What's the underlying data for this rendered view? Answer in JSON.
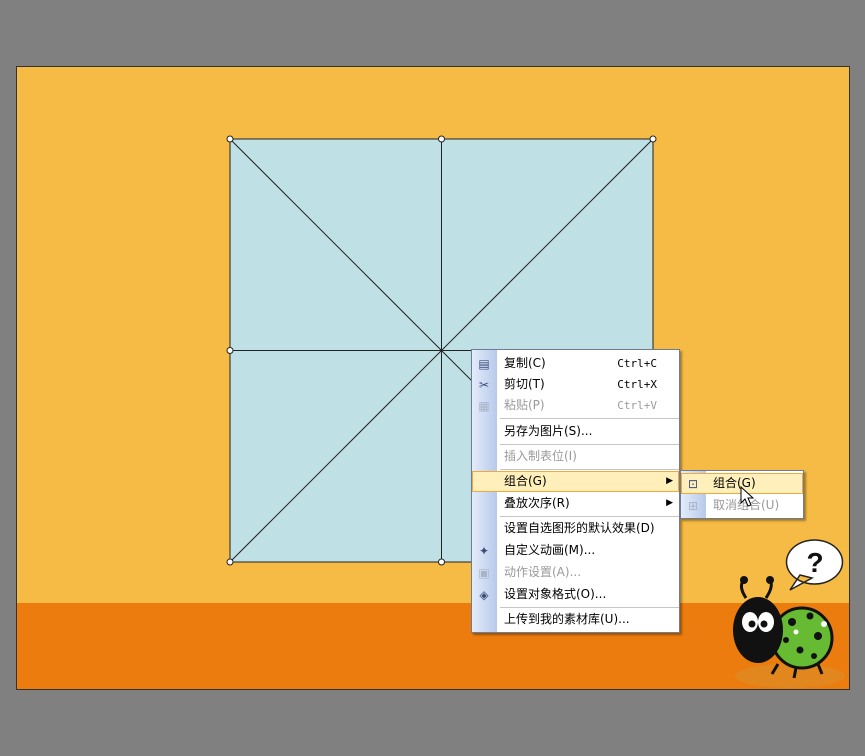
{
  "colors": {
    "desktop": "#808080",
    "slide_background": "#f6bb44",
    "slide_band": "#ec7c0e",
    "shape_fill": "#bfe0e4",
    "menu_highlight": "#ffefbb"
  },
  "context_menu": {
    "items": [
      {
        "label": "复制(C)",
        "shortcut": "Ctrl+C",
        "icon": "copy-icon",
        "disabled": false
      },
      {
        "label": "剪切(T)",
        "shortcut": "Ctrl+X",
        "icon": "cut-icon",
        "disabled": false
      },
      {
        "label": "粘贴(P)",
        "shortcut": "Ctrl+V",
        "icon": "paste-icon",
        "disabled": true
      },
      {
        "label": "另存为图片(S)...",
        "disabled": false
      },
      {
        "label": "插入制表位(I)",
        "disabled": true
      },
      {
        "label": "组合(G)",
        "disabled": false,
        "submenu": true,
        "highlighted": true
      },
      {
        "label": "叠放次序(R)",
        "disabled": false,
        "submenu": true
      },
      {
        "label": "设置自选图形的默认效果(D)",
        "disabled": false
      },
      {
        "label": "自定义动画(M)...",
        "icon": "custom-animation-icon",
        "disabled": false
      },
      {
        "label": "动作设置(A)...",
        "icon": "action-settings-icon",
        "disabled": true
      },
      {
        "label": "设置对象格式(O)...",
        "icon": "format-object-icon",
        "disabled": false
      },
      {
        "label": "上传到我的素材库(U)...",
        "disabled": false
      }
    ]
  },
  "submenu": {
    "items": [
      {
        "label": "组合(G)",
        "icon": "group-icon",
        "highlighted": true,
        "disabled": false
      },
      {
        "label": "取消组合(U)",
        "icon": "ungroup-icon",
        "disabled": true
      }
    ]
  },
  "mascot": {
    "bubble_text": "?",
    "description_icon": "ladybug-mascot-icon"
  }
}
